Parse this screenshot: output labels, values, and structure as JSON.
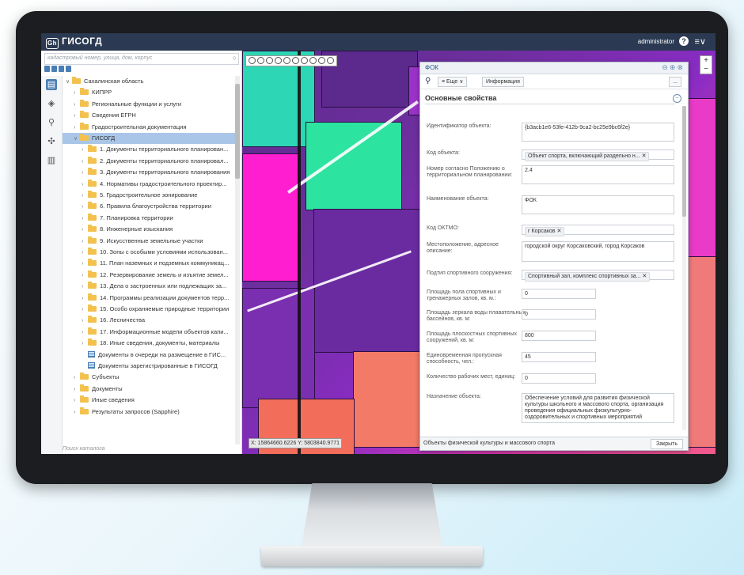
{
  "app": {
    "logo_icon": "Gh",
    "title": "ГИСОГД",
    "user": "administrator",
    "help": "?",
    "menu": "≡∨"
  },
  "search": {
    "placeholder": "кадастровый номер, улица, дом, корпус"
  },
  "tree": [
    {
      "label": "Сахалинская область",
      "level": 0,
      "arrow": "∨",
      "type": "folder"
    },
    {
      "label": "КИПРР",
      "level": 1,
      "arrow": "›",
      "type": "folder"
    },
    {
      "label": "Региональные функции и услуги",
      "level": 1,
      "arrow": "›",
      "type": "folder"
    },
    {
      "label": "Сведения ЕГРН",
      "level": 1,
      "arrow": "›",
      "type": "folder"
    },
    {
      "label": "Градостроительная документация",
      "level": 1,
      "arrow": "›",
      "type": "folder"
    },
    {
      "label": "ГИСОГД",
      "level": 1,
      "arrow": "∨",
      "type": "folder",
      "selected": true
    },
    {
      "label": "1. Документы территориального планирован...",
      "level": 2,
      "arrow": "›",
      "type": "folder"
    },
    {
      "label": "2. Документы территориального планировал...",
      "level": 2,
      "arrow": "›",
      "type": "folder"
    },
    {
      "label": "3. Документы территориального планирования",
      "level": 2,
      "arrow": "›",
      "type": "folder"
    },
    {
      "label": "4. Нормативы градостроительного проектир...",
      "level": 2,
      "arrow": "›",
      "type": "folder"
    },
    {
      "label": "5. Градостроительное зонирование",
      "level": 2,
      "arrow": "›",
      "type": "folder"
    },
    {
      "label": "6. Правила благоустройства территории",
      "level": 2,
      "arrow": "›",
      "type": "folder"
    },
    {
      "label": "7. Планировка территории",
      "level": 2,
      "arrow": "›",
      "type": "folder"
    },
    {
      "label": "8. Инженерные изыскания",
      "level": 2,
      "arrow": "›",
      "type": "folder"
    },
    {
      "label": "9. Искусственные земельные участки",
      "level": 2,
      "arrow": "›",
      "type": "folder"
    },
    {
      "label": "10. Зоны с особыми условиями использован...",
      "level": 2,
      "arrow": "›",
      "type": "folder"
    },
    {
      "label": "11. План наземных и подземных коммуникац...",
      "level": 2,
      "arrow": "›",
      "type": "folder"
    },
    {
      "label": "12. Резервирование земель и изъятие земел...",
      "level": 2,
      "arrow": "›",
      "type": "folder"
    },
    {
      "label": "13. Дела о застроенных или подлежащих за...",
      "level": 2,
      "arrow": "›",
      "type": "folder"
    },
    {
      "label": "14. Программы реализации документов терр...",
      "level": 2,
      "arrow": "›",
      "type": "folder"
    },
    {
      "label": "15. Особо охраняемые природные территории",
      "level": 2,
      "arrow": "›",
      "type": "folder"
    },
    {
      "label": "16. Лесничества",
      "level": 2,
      "arrow": "›",
      "type": "folder"
    },
    {
      "label": "17. Информационные модели объектов капи...",
      "level": 2,
      "arrow": "›",
      "type": "folder"
    },
    {
      "label": "18. Иные сведения, документы, материалы",
      "level": 2,
      "arrow": "›",
      "type": "folder"
    },
    {
      "label": "Документы в очереди на размещение в ГИС...",
      "level": 2,
      "arrow": "",
      "type": "table"
    },
    {
      "label": "Документы зарегистрированные в ГИСОГД",
      "level": 2,
      "arrow": "",
      "type": "table"
    },
    {
      "label": "Субъекты",
      "level": 1,
      "arrow": "›",
      "type": "folder"
    },
    {
      "label": "Документы",
      "level": 1,
      "arrow": "›",
      "type": "folder"
    },
    {
      "label": "Иные сведения",
      "level": 1,
      "arrow": "›",
      "type": "folder"
    },
    {
      "label": "Результаты запросов (Sapphire)",
      "level": 1,
      "arrow": "›",
      "type": "folder"
    }
  ],
  "catalog_search": "Поиск каталога",
  "map": {
    "coord_x": "X: 15864660.6226",
    "coord_y": "Y: 5803840.9771"
  },
  "dialog": {
    "title": "ФОК",
    "controls": "⊖⊕⊗",
    "more_label": "Еще",
    "info_label": "Информация",
    "dots_label": "...",
    "section_title": "Основные свойства",
    "fields": [
      {
        "label": "Идентификатор объекта:",
        "value": "{b3acb1e6-53fe-412b-9ca2-bc25e9bc6f2e}",
        "kind": "text"
      },
      {
        "label": "Код объекта:",
        "value": "Объект спорта, включающий раздельно н...",
        "kind": "tag"
      },
      {
        "label": "Номер согласно Положению о территориальном планировании:",
        "value": "2.4",
        "kind": "text"
      },
      {
        "label": "Наименование объекта:",
        "value": "ФОК",
        "kind": "text"
      },
      {
        "label": "Код ОКТМО:",
        "value": "г Корсаков",
        "kind": "tag"
      },
      {
        "label": "Местоположение, адресное описание:",
        "value": "городской округ Корсаковский, город Корсаков",
        "kind": "text"
      },
      {
        "label": "Подтип спортивного сооружения:",
        "value": "Спортивный зал, комплекс спортивных за...",
        "kind": "tag"
      },
      {
        "label": "Площадь пола спортивных и тренажерных залов, кв. м.:",
        "value": "0",
        "kind": "num"
      },
      {
        "label": "Площадь зеркала воды плавательных бассейнов, кв. м:",
        "value": "0",
        "kind": "num"
      },
      {
        "label": "Площадь плоскостных спортивных сооружений, кв. м:",
        "value": "800",
        "kind": "num"
      },
      {
        "label": "Единовременная пропускная способность, чел.:",
        "value": "45",
        "kind": "num"
      },
      {
        "label": "Количество рабочих мест, единиц:",
        "value": "0",
        "kind": "num"
      },
      {
        "label": "Назначение объекта:",
        "value": "Обеспечение условий для развития физической культуры школьного и массового спорта, организация проведения официальных физкультурно-оздоровительных и спортивных мероприятий",
        "kind": "text"
      }
    ],
    "footer_text": "Объекты физической культуры и массового спорта",
    "close_label": "Закрыть"
  }
}
